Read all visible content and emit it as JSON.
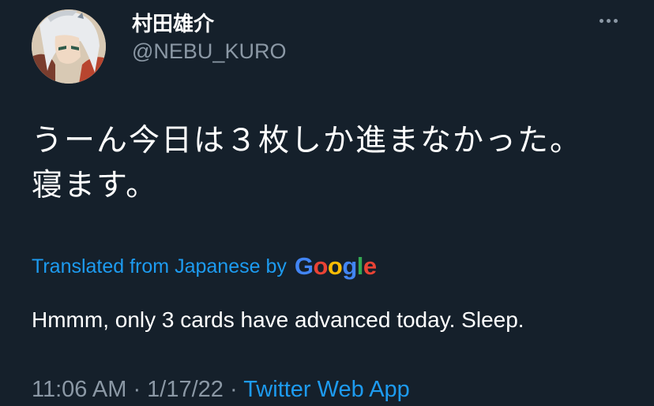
{
  "author": {
    "display_name": "村田雄介",
    "handle": "@NEBU_KURO",
    "avatar_icon": "user-avatar-icon"
  },
  "menu": {
    "icon": "more-dots-icon"
  },
  "tweet": {
    "text_lines": [
      "うーん今日は３枚しか進まなかった。",
      "寝ます。"
    ]
  },
  "translation": {
    "label": "Translated from Japanese by",
    "provider": "Google",
    "text": "Hmmm, only 3 cards have advanced today. Sleep."
  },
  "meta": {
    "time": "11:06 AM",
    "separator": " · ",
    "date": "1/17/22",
    "source": "Twitter Web App"
  },
  "colors": {
    "background": "#15202b",
    "text": "#ffffff",
    "secondary": "#8b98a5",
    "link": "#1d9bf0",
    "google_blue": "#4285F4",
    "google_red": "#EA4335",
    "google_yellow": "#FBBC05",
    "google_green": "#34A853"
  }
}
